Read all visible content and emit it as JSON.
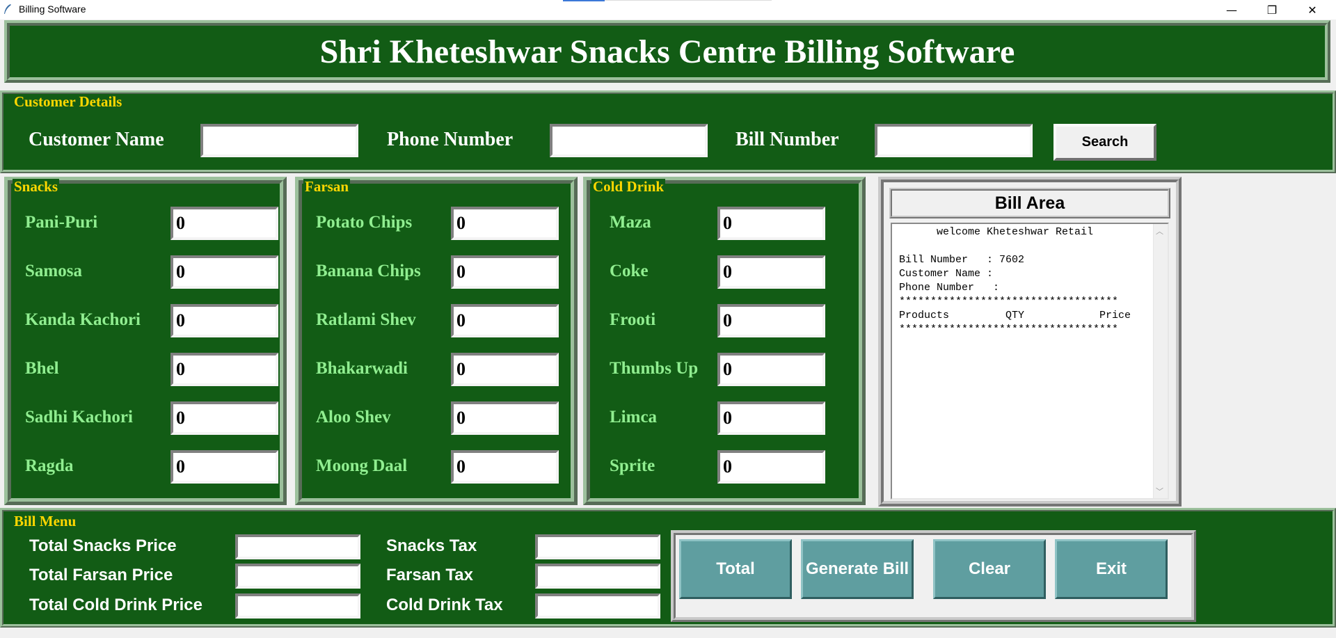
{
  "window": {
    "title": "Billing Software",
    "minimize": "—",
    "maximize": "❐",
    "close": "✕"
  },
  "heading": "Shri Kheteshwar Snacks Centre Billing Software",
  "customer": {
    "frame_title": "Customer Details",
    "name_label": "Customer Name",
    "name_value": "",
    "phone_label": "Phone Number",
    "phone_value": "",
    "bill_label": "Bill Number",
    "bill_value": "",
    "search_label": "Search"
  },
  "snacks": {
    "title": "Snacks",
    "items": [
      {
        "label": "Pani-Puri",
        "qty": "0"
      },
      {
        "label": "Samosa",
        "qty": "0"
      },
      {
        "label": "Kanda Kachori",
        "qty": "0"
      },
      {
        "label": "Bhel",
        "qty": "0"
      },
      {
        "label": "Sadhi Kachori",
        "qty": "0"
      },
      {
        "label": "Ragda",
        "qty": "0"
      }
    ]
  },
  "farsan": {
    "title": "Farsan",
    "items": [
      {
        "label": "Potato Chips",
        "qty": "0"
      },
      {
        "label": "Banana Chips",
        "qty": "0"
      },
      {
        "label": "Ratlami Shev",
        "qty": "0"
      },
      {
        "label": "Bhakarwadi",
        "qty": "0"
      },
      {
        "label": "Aloo Shev",
        "qty": "0"
      },
      {
        "label": "Moong Daal",
        "qty": "0"
      }
    ]
  },
  "colddrink": {
    "title": "Cold Drink",
    "items": [
      {
        "label": "Maza",
        "qty": "0"
      },
      {
        "label": "Coke",
        "qty": "0"
      },
      {
        "label": "Frooti",
        "qty": "0"
      },
      {
        "label": "Thumbs Up",
        "qty": "0"
      },
      {
        "label": "Limca",
        "qty": "0"
      },
      {
        "label": "Sprite",
        "qty": "0"
      }
    ]
  },
  "bill_area": {
    "title": "Bill Area",
    "lines": [
      "      welcome Kheteshwar Retail",
      "",
      "Bill Number   : 7602",
      "Customer Name :",
      "Phone Number   :",
      "***********************************",
      "Products         QTY            Price",
      "***********************************"
    ]
  },
  "bill_menu": {
    "title": "Bill Menu",
    "total_snacks_label": "Total Snacks Price",
    "total_snacks_value": "",
    "total_farsan_label": "Total Farsan Price",
    "total_farsan_value": "",
    "total_cold_label": "Total Cold Drink Price",
    "total_cold_value": "",
    "snacks_tax_label": "Snacks Tax",
    "snacks_tax_value": "",
    "farsan_tax_label": "Farsan Tax",
    "farsan_tax_value": "",
    "cold_tax_label": "Cold Drink Tax",
    "cold_tax_value": "",
    "buttons": {
      "total": "Total",
      "generate": "Generate Bill",
      "clear": "Clear",
      "exit": "Exit"
    }
  },
  "colors": {
    "frame_green": "#125c15",
    "label_yellow": "#ffd700",
    "item_green": "#90ee90",
    "button_teal": "#5f9ea0"
  }
}
